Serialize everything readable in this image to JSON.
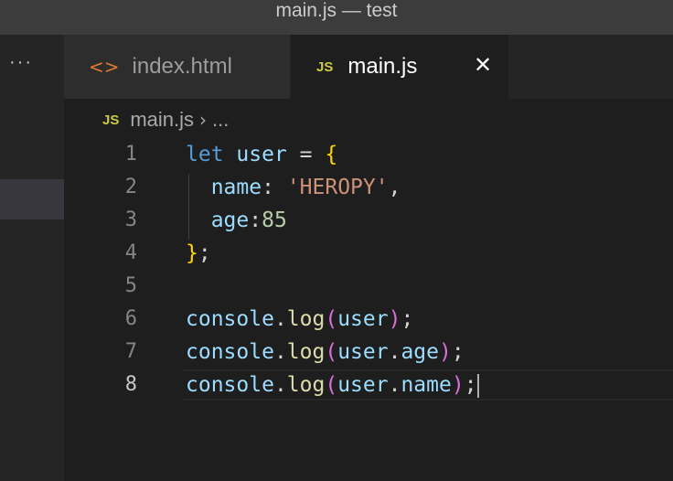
{
  "window": {
    "title": "main.js — test"
  },
  "sidebar": {
    "more_label": "···"
  },
  "tabs": [
    {
      "label": "index.html",
      "icon": "html-file-icon",
      "icon_glyph": "<>",
      "active": false
    },
    {
      "label": "main.js",
      "icon": "js-file-icon",
      "icon_glyph": "JS",
      "active": true,
      "close_glyph": "✕"
    }
  ],
  "breadcrumb": {
    "icon_glyph": "JS",
    "file": "main.js",
    "separator": "›",
    "rest": "..."
  },
  "editor": {
    "active_line": 8,
    "lines": [
      {
        "number": "1",
        "tokens": {
          "kw": "let",
          "var": "user",
          "op": "=",
          "brace": "{"
        }
      },
      {
        "number": "2",
        "tokens": {
          "prop": "name",
          "colon": ":",
          "str": "'HEROPY'",
          "comma": ","
        }
      },
      {
        "number": "3",
        "tokens": {
          "prop": "age",
          "colon": ":",
          "num": "85"
        }
      },
      {
        "number": "4",
        "tokens": {
          "brace": "}",
          "semi": ";"
        }
      },
      {
        "number": "5",
        "tokens": {}
      },
      {
        "number": "6",
        "tokens": {
          "obj": "console",
          "dot": ".",
          "fn": "log",
          "open": "(",
          "arg": "user",
          "close": ")",
          "semi": ";"
        }
      },
      {
        "number": "7",
        "tokens": {
          "obj": "console",
          "dot": ".",
          "fn": "log",
          "open": "(",
          "arg": "user",
          "dot2": ".",
          "arg2": "age",
          "close": ")",
          "semi": ";"
        }
      },
      {
        "number": "8",
        "tokens": {
          "obj": "console",
          "dot": ".",
          "fn": "log",
          "open": "(",
          "arg": "user",
          "dot2": ".",
          "arg2": "name",
          "close": ")",
          "semi": ";"
        }
      }
    ]
  },
  "colors": {
    "keyword": "#569cd6",
    "variable": "#9cdcfe",
    "function": "#dcdcaa",
    "string": "#ce9178",
    "number": "#b5cea8",
    "bracket": "#ffd700",
    "bracket_nested": "#da70d6"
  }
}
